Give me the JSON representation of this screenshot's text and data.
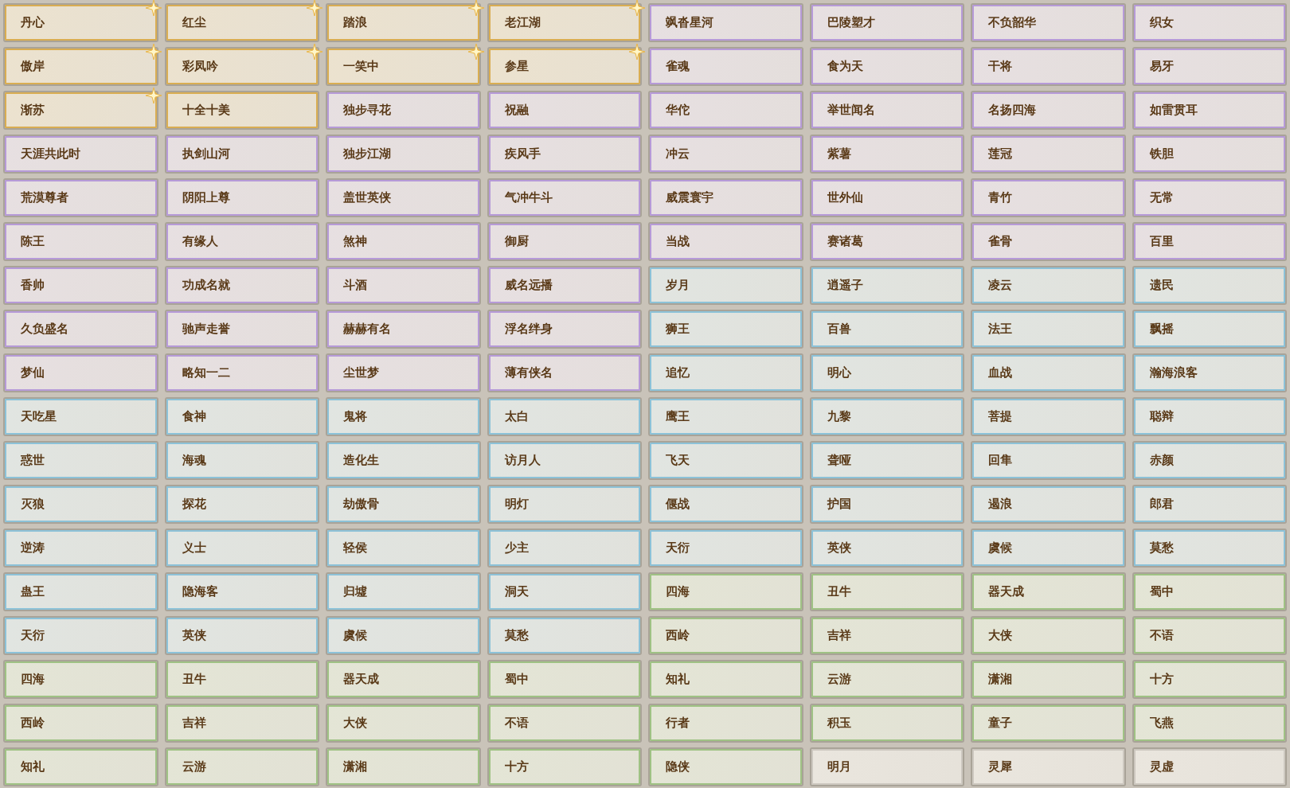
{
  "rows": [
    [
      {
        "label": "丹心",
        "color": "#d9ad52",
        "starred": true
      },
      {
        "label": "红尘",
        "color": "#d9ad52",
        "starred": true
      },
      {
        "label": "踏浪",
        "color": "#d9ad52",
        "starred": true
      },
      {
        "label": "老江湖",
        "color": "#d9ad52",
        "starred": true
      },
      {
        "label": "飒沓星河",
        "color": "#b69ad8",
        "starred": false
      },
      {
        "label": "巴陵塑才",
        "color": "#b69ad8",
        "starred": false
      },
      {
        "label": "不负韶华",
        "color": "#b69ad8",
        "starred": false
      },
      {
        "label": "织女",
        "color": "#b69ad8",
        "starred": false
      }
    ],
    [
      {
        "label": "傲岸",
        "color": "#d9ad52",
        "starred": true
      },
      {
        "label": "彩凤吟",
        "color": "#d9ad52",
        "starred": true
      },
      {
        "label": "一笑中",
        "color": "#d9ad52",
        "starred": true
      },
      {
        "label": "参星",
        "color": "#d9ad52",
        "starred": true
      },
      {
        "label": "雀魂",
        "color": "#b69ad8",
        "starred": false
      },
      {
        "label": "食为天",
        "color": "#b69ad8",
        "starred": false
      },
      {
        "label": "干将",
        "color": "#b69ad8",
        "starred": false
      },
      {
        "label": "易牙",
        "color": "#b69ad8",
        "starred": false
      }
    ],
    [
      {
        "label": "渐苏",
        "color": "#d9ad52",
        "starred": true
      },
      {
        "label": "十全十美",
        "color": "#d9ad52",
        "starred": false
      },
      {
        "label": "独步寻花",
        "color": "#b69ad8",
        "starred": false
      },
      {
        "label": "祝融",
        "color": "#b69ad8",
        "starred": false
      },
      {
        "label": "华佗",
        "color": "#b69ad8",
        "starred": false
      },
      {
        "label": "举世闻名",
        "color": "#b69ad8",
        "starred": false
      },
      {
        "label": "名扬四海",
        "color": "#b69ad8",
        "starred": false
      },
      {
        "label": "如雷贯耳",
        "color": "#b69ad8",
        "starred": false
      }
    ],
    [
      {
        "label": "天涯共此时",
        "color": "#b69ad8",
        "starred": false
      },
      {
        "label": "执剑山河",
        "color": "#b69ad8",
        "starred": false
      },
      {
        "label": "独步江湖",
        "color": "#b69ad8",
        "starred": false
      },
      {
        "label": "疾风手",
        "color": "#b69ad8",
        "starred": false
      },
      {
        "label": "冲云",
        "color": "#b69ad8",
        "starred": false
      },
      {
        "label": "紫薯",
        "color": "#b69ad8",
        "starred": false
      },
      {
        "label": "莲冠",
        "color": "#b69ad8",
        "starred": false
      },
      {
        "label": "铁胆",
        "color": "#b69ad8",
        "starred": false
      }
    ],
    [
      {
        "label": "荒漠尊者",
        "color": "#b69ad8",
        "starred": false
      },
      {
        "label": "阴阳上尊",
        "color": "#b69ad8",
        "starred": false
      },
      {
        "label": "盖世英侠",
        "color": "#b69ad8",
        "starred": false
      },
      {
        "label": "气冲牛斗",
        "color": "#b69ad8",
        "starred": false
      },
      {
        "label": "威震寰宇",
        "color": "#b69ad8",
        "starred": false
      },
      {
        "label": "世外仙",
        "color": "#b69ad8",
        "starred": false
      },
      {
        "label": "青竹",
        "color": "#b69ad8",
        "starred": false
      },
      {
        "label": "无常",
        "color": "#b69ad8",
        "starred": false
      }
    ],
    [
      {
        "label": "陈王",
        "color": "#b69ad8",
        "starred": false
      },
      {
        "label": "有缘人",
        "color": "#b69ad8",
        "starred": false
      },
      {
        "label": "煞神",
        "color": "#b69ad8",
        "starred": false
      },
      {
        "label": "御厨",
        "color": "#b69ad8",
        "starred": false
      },
      {
        "label": "当战",
        "color": "#b69ad8",
        "starred": false
      },
      {
        "label": "赛诸葛",
        "color": "#b69ad8",
        "starred": false
      },
      {
        "label": "雀骨",
        "color": "#b69ad8",
        "starred": false
      },
      {
        "label": "百里",
        "color": "#b69ad8",
        "starred": false
      }
    ],
    [
      {
        "label": "香帅",
        "color": "#b69ad8",
        "starred": false
      },
      {
        "label": "功成名就",
        "color": "#b69ad8",
        "starred": false
      },
      {
        "label": "斗酒",
        "color": "#b69ad8",
        "starred": false
      },
      {
        "label": "威名远播",
        "color": "#b69ad8",
        "starred": false
      },
      {
        "label": "岁月",
        "color": "#8cc2d8",
        "starred": false
      },
      {
        "label": "逍遥子",
        "color": "#8cc2d8",
        "starred": false
      },
      {
        "label": "凌云",
        "color": "#8cc2d8",
        "starred": false
      },
      {
        "label": "遗民",
        "color": "#8cc2d8",
        "starred": false
      }
    ],
    [
      {
        "label": "久负盛名",
        "color": "#b69ad8",
        "starred": false
      },
      {
        "label": "驰声走誉",
        "color": "#b69ad8",
        "starred": false
      },
      {
        "label": "赫赫有名",
        "color": "#b69ad8",
        "starred": false
      },
      {
        "label": "浮名绊身",
        "color": "#b69ad8",
        "starred": false
      },
      {
        "label": "狮王",
        "color": "#8cc2d8",
        "starred": false
      },
      {
        "label": "百兽",
        "color": "#8cc2d8",
        "starred": false
      },
      {
        "label": "法王",
        "color": "#8cc2d8",
        "starred": false
      },
      {
        "label": "飘摇",
        "color": "#8cc2d8",
        "starred": false
      }
    ],
    [
      {
        "label": "梦仙",
        "color": "#b69ad8",
        "starred": false
      },
      {
        "label": "略知一二",
        "color": "#b69ad8",
        "starred": false
      },
      {
        "label": "尘世梦",
        "color": "#b69ad8",
        "starred": false
      },
      {
        "label": "薄有侠名",
        "color": "#b69ad8",
        "starred": false
      },
      {
        "label": "追忆",
        "color": "#8cc2d8",
        "starred": false
      },
      {
        "label": "明心",
        "color": "#8cc2d8",
        "starred": false
      },
      {
        "label": "血战",
        "color": "#8cc2d8",
        "starred": false
      },
      {
        "label": "瀚海浪客",
        "color": "#8cc2d8",
        "starred": false
      }
    ],
    [
      {
        "label": "天吃星",
        "color": "#8cc2d8",
        "starred": false
      },
      {
        "label": "食神",
        "color": "#8cc2d8",
        "starred": false
      },
      {
        "label": "鬼将",
        "color": "#8cc2d8",
        "starred": false
      },
      {
        "label": "太白",
        "color": "#8cc2d8",
        "starred": false
      },
      {
        "label": "鹰王",
        "color": "#8cc2d8",
        "starred": false
      },
      {
        "label": "九黎",
        "color": "#8cc2d8",
        "starred": false
      },
      {
        "label": "菩提",
        "color": "#8cc2d8",
        "starred": false
      },
      {
        "label": "聪辩",
        "color": "#8cc2d8",
        "starred": false
      }
    ],
    [
      {
        "label": "惑世",
        "color": "#8cc2d8",
        "starred": false
      },
      {
        "label": "海魂",
        "color": "#8cc2d8",
        "starred": false
      },
      {
        "label": "造化生",
        "color": "#8cc2d8",
        "starred": false
      },
      {
        "label": "访月人",
        "color": "#8cc2d8",
        "starred": false
      },
      {
        "label": "飞天",
        "color": "#8cc2d8",
        "starred": false
      },
      {
        "label": "聋哑",
        "color": "#8cc2d8",
        "starred": false
      },
      {
        "label": "回隼",
        "color": "#8cc2d8",
        "starred": false
      },
      {
        "label": "赤颜",
        "color": "#8cc2d8",
        "starred": false
      }
    ],
    [
      {
        "label": "灭狼",
        "color": "#8cc2d8",
        "starred": false
      },
      {
        "label": "探花",
        "color": "#8cc2d8",
        "starred": false
      },
      {
        "label": "劫傲骨",
        "color": "#8cc2d8",
        "starred": false
      },
      {
        "label": "明灯",
        "color": "#8cc2d8",
        "starred": false
      },
      {
        "label": "偃战",
        "color": "#8cc2d8",
        "starred": false
      },
      {
        "label": "护国",
        "color": "#8cc2d8",
        "starred": false
      },
      {
        "label": "遏浪",
        "color": "#8cc2d8",
        "starred": false
      },
      {
        "label": "郎君",
        "color": "#8cc2d8",
        "starred": false
      }
    ],
    [
      {
        "label": "逆涛",
        "color": "#8cc2d8",
        "starred": false
      },
      {
        "label": "义士",
        "color": "#8cc2d8",
        "starred": false
      },
      {
        "label": "轻侯",
        "color": "#8cc2d8",
        "starred": false
      },
      {
        "label": "少主",
        "color": "#8cc2d8",
        "starred": false
      },
      {
        "label": "天衍",
        "color": "#8cc2d8",
        "starred": false
      },
      {
        "label": "英侠",
        "color": "#8cc2d8",
        "starred": false
      },
      {
        "label": "虞候",
        "color": "#8cc2d8",
        "starred": false
      },
      {
        "label": "莫愁",
        "color": "#8cc2d8",
        "starred": false
      }
    ],
    [
      {
        "label": "蛊王",
        "color": "#8cc2d8",
        "starred": false
      },
      {
        "label": "隐海客",
        "color": "#8cc2d8",
        "starred": false
      },
      {
        "label": "归墟",
        "color": "#8cc2d8",
        "starred": false
      },
      {
        "label": "洞天",
        "color": "#8cc2d8",
        "starred": false
      },
      {
        "label": "四海",
        "color": "#9fc284",
        "starred": false
      },
      {
        "label": "丑牛",
        "color": "#9fc284",
        "starred": false
      },
      {
        "label": "器天成",
        "color": "#9fc284",
        "starred": false
      },
      {
        "label": "蜀中",
        "color": "#9fc284",
        "starred": false
      }
    ],
    [
      {
        "label": "天衍",
        "color": "#8cc2d8",
        "starred": false
      },
      {
        "label": "英侠",
        "color": "#8cc2d8",
        "starred": false
      },
      {
        "label": "虞候",
        "color": "#8cc2d8",
        "starred": false
      },
      {
        "label": "莫愁",
        "color": "#8cc2d8",
        "starred": false
      },
      {
        "label": "西岭",
        "color": "#9fc284",
        "starred": false
      },
      {
        "label": "吉祥",
        "color": "#9fc284",
        "starred": false
      },
      {
        "label": "大侠",
        "color": "#9fc284",
        "starred": false
      },
      {
        "label": "不语",
        "color": "#9fc284",
        "starred": false
      }
    ],
    [
      {
        "label": "四海",
        "color": "#9fc284",
        "starred": false
      },
      {
        "label": "丑牛",
        "color": "#9fc284",
        "starred": false
      },
      {
        "label": "器天成",
        "color": "#9fc284",
        "starred": false
      },
      {
        "label": "蜀中",
        "color": "#9fc284",
        "starred": false
      },
      {
        "label": "知礼",
        "color": "#9fc284",
        "starred": false
      },
      {
        "label": "云游",
        "color": "#9fc284",
        "starred": false
      },
      {
        "label": "潇湘",
        "color": "#9fc284",
        "starred": false
      },
      {
        "label": "十方",
        "color": "#9fc284",
        "starred": false
      }
    ],
    [
      {
        "label": "西岭",
        "color": "#9fc284",
        "starred": false
      },
      {
        "label": "吉祥",
        "color": "#9fc284",
        "starred": false
      },
      {
        "label": "大侠",
        "color": "#9fc284",
        "starred": false
      },
      {
        "label": "不语",
        "color": "#9fc284",
        "starred": false
      },
      {
        "label": "行者",
        "color": "#9fc284",
        "starred": false
      },
      {
        "label": "积玉",
        "color": "#9fc284",
        "starred": false
      },
      {
        "label": "童子",
        "color": "#9fc284",
        "starred": false
      },
      {
        "label": "飞燕",
        "color": "#9fc284",
        "starred": false
      }
    ],
    [
      {
        "label": "知礼",
        "color": "#9fc284",
        "starred": false
      },
      {
        "label": "云游",
        "color": "#9fc284",
        "starred": false
      },
      {
        "label": "潇湘",
        "color": "#9fc284",
        "starred": false
      },
      {
        "label": "十方",
        "color": "#9fc284",
        "starred": false
      },
      {
        "label": "隐侠",
        "color": "#9fc284",
        "starred": false
      },
      {
        "label": "明月",
        "color": "#cdc8c0",
        "starred": false
      },
      {
        "label": "灵犀",
        "color": "#cdc8c0",
        "starred": false
      },
      {
        "label": "灵虚",
        "color": "#cdc8c0",
        "starred": false
      }
    ]
  ]
}
